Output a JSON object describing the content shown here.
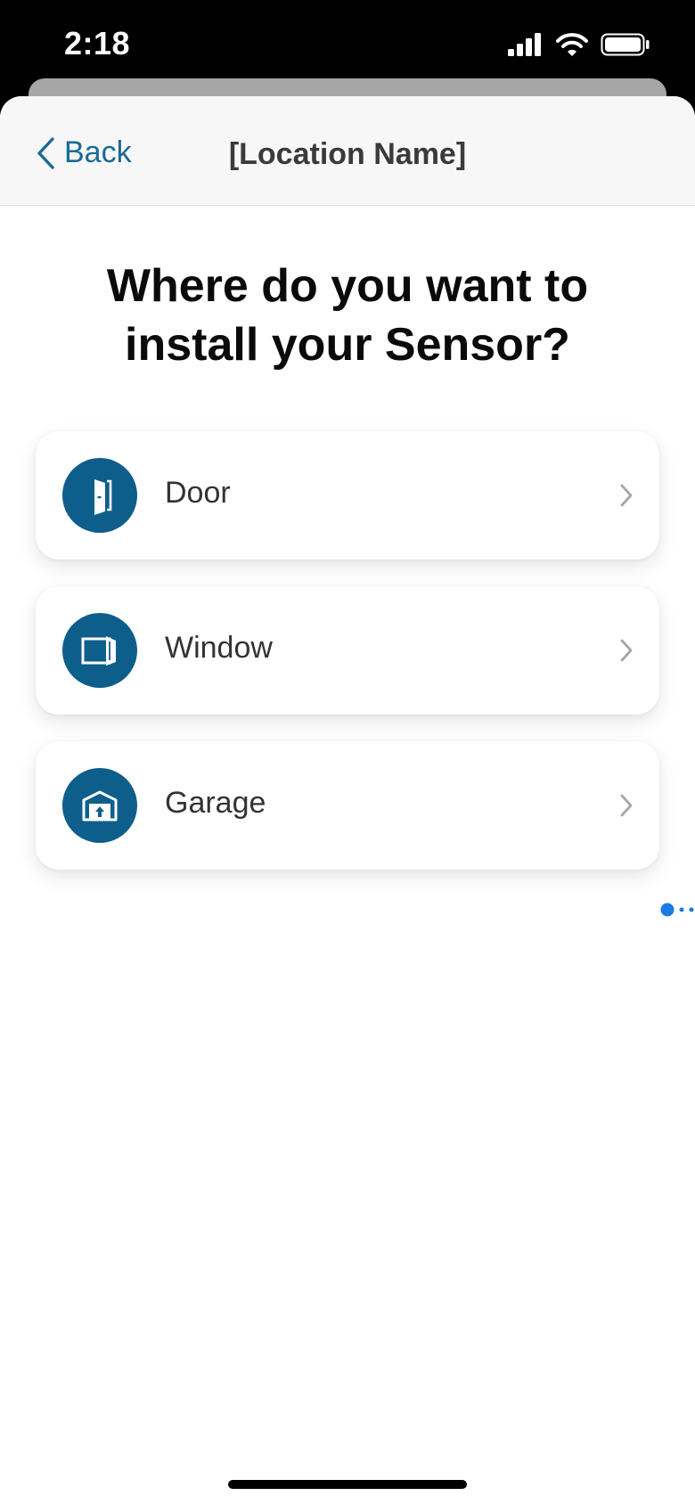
{
  "status_bar": {
    "time": "2:18"
  },
  "nav": {
    "back_label": "Back",
    "title": "[Location Name]"
  },
  "page": {
    "title": "Where do you want to install your Sensor?"
  },
  "options": [
    {
      "label": "Door",
      "icon": "door-icon"
    },
    {
      "label": "Window",
      "icon": "window-icon"
    },
    {
      "label": "Garage",
      "icon": "garage-icon"
    }
  ],
  "colors": {
    "accent": "#1a6a97",
    "icon_circle": "#0e5e8c",
    "drag_dot": "#1a7be6"
  }
}
